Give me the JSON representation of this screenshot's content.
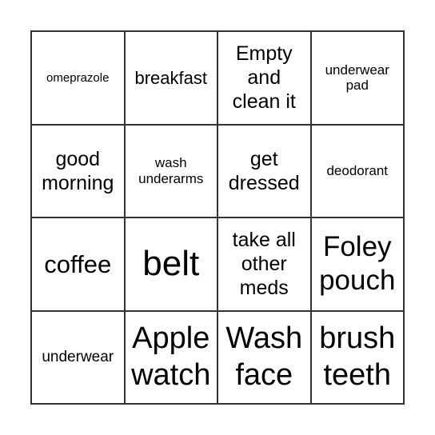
{
  "bingo": {
    "cells": [
      "omeprazole",
      "breakfast",
      "Empty and clean it",
      "underwear pad",
      "good morning",
      "wash underarms",
      "get dressed",
      "deodorant",
      "coffee",
      "belt",
      "take all other meds",
      "Foley pouch",
      "underwear",
      "Apple watch",
      "Wash face",
      "brush teeth"
    ]
  }
}
